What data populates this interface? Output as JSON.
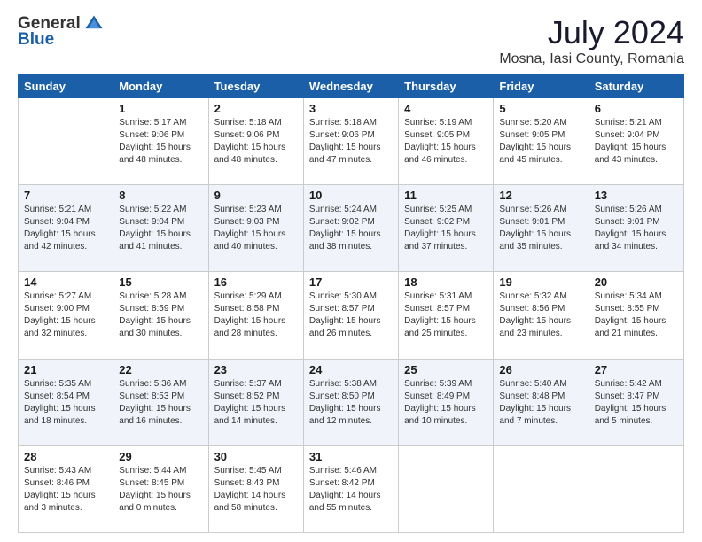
{
  "header": {
    "logo": {
      "general": "General",
      "blue": "Blue"
    },
    "title": "July 2024",
    "subtitle": "Mosna, Iasi County, Romania"
  },
  "days_of_week": [
    "Sunday",
    "Monday",
    "Tuesday",
    "Wednesday",
    "Thursday",
    "Friday",
    "Saturday"
  ],
  "weeks": [
    [
      {
        "day": "",
        "info": ""
      },
      {
        "day": "1",
        "info": "Sunrise: 5:17 AM\nSunset: 9:06 PM\nDaylight: 15 hours\nand 48 minutes."
      },
      {
        "day": "2",
        "info": "Sunrise: 5:18 AM\nSunset: 9:06 PM\nDaylight: 15 hours\nand 48 minutes."
      },
      {
        "day": "3",
        "info": "Sunrise: 5:18 AM\nSunset: 9:06 PM\nDaylight: 15 hours\nand 47 minutes."
      },
      {
        "day": "4",
        "info": "Sunrise: 5:19 AM\nSunset: 9:05 PM\nDaylight: 15 hours\nand 46 minutes."
      },
      {
        "day": "5",
        "info": "Sunrise: 5:20 AM\nSunset: 9:05 PM\nDaylight: 15 hours\nand 45 minutes."
      },
      {
        "day": "6",
        "info": "Sunrise: 5:21 AM\nSunset: 9:04 PM\nDaylight: 15 hours\nand 43 minutes."
      }
    ],
    [
      {
        "day": "7",
        "info": "Sunrise: 5:21 AM\nSunset: 9:04 PM\nDaylight: 15 hours\nand 42 minutes."
      },
      {
        "day": "8",
        "info": "Sunrise: 5:22 AM\nSunset: 9:04 PM\nDaylight: 15 hours\nand 41 minutes."
      },
      {
        "day": "9",
        "info": "Sunrise: 5:23 AM\nSunset: 9:03 PM\nDaylight: 15 hours\nand 40 minutes."
      },
      {
        "day": "10",
        "info": "Sunrise: 5:24 AM\nSunset: 9:02 PM\nDaylight: 15 hours\nand 38 minutes."
      },
      {
        "day": "11",
        "info": "Sunrise: 5:25 AM\nSunset: 9:02 PM\nDaylight: 15 hours\nand 37 minutes."
      },
      {
        "day": "12",
        "info": "Sunrise: 5:26 AM\nSunset: 9:01 PM\nDaylight: 15 hours\nand 35 minutes."
      },
      {
        "day": "13",
        "info": "Sunrise: 5:26 AM\nSunset: 9:01 PM\nDaylight: 15 hours\nand 34 minutes."
      }
    ],
    [
      {
        "day": "14",
        "info": "Sunrise: 5:27 AM\nSunset: 9:00 PM\nDaylight: 15 hours\nand 32 minutes."
      },
      {
        "day": "15",
        "info": "Sunrise: 5:28 AM\nSunset: 8:59 PM\nDaylight: 15 hours\nand 30 minutes."
      },
      {
        "day": "16",
        "info": "Sunrise: 5:29 AM\nSunset: 8:58 PM\nDaylight: 15 hours\nand 28 minutes."
      },
      {
        "day": "17",
        "info": "Sunrise: 5:30 AM\nSunset: 8:57 PM\nDaylight: 15 hours\nand 26 minutes."
      },
      {
        "day": "18",
        "info": "Sunrise: 5:31 AM\nSunset: 8:57 PM\nDaylight: 15 hours\nand 25 minutes."
      },
      {
        "day": "19",
        "info": "Sunrise: 5:32 AM\nSunset: 8:56 PM\nDaylight: 15 hours\nand 23 minutes."
      },
      {
        "day": "20",
        "info": "Sunrise: 5:34 AM\nSunset: 8:55 PM\nDaylight: 15 hours\nand 21 minutes."
      }
    ],
    [
      {
        "day": "21",
        "info": "Sunrise: 5:35 AM\nSunset: 8:54 PM\nDaylight: 15 hours\nand 18 minutes."
      },
      {
        "day": "22",
        "info": "Sunrise: 5:36 AM\nSunset: 8:53 PM\nDaylight: 15 hours\nand 16 minutes."
      },
      {
        "day": "23",
        "info": "Sunrise: 5:37 AM\nSunset: 8:52 PM\nDaylight: 15 hours\nand 14 minutes."
      },
      {
        "day": "24",
        "info": "Sunrise: 5:38 AM\nSunset: 8:50 PM\nDaylight: 15 hours\nand 12 minutes."
      },
      {
        "day": "25",
        "info": "Sunrise: 5:39 AM\nSunset: 8:49 PM\nDaylight: 15 hours\nand 10 minutes."
      },
      {
        "day": "26",
        "info": "Sunrise: 5:40 AM\nSunset: 8:48 PM\nDaylight: 15 hours\nand 7 minutes."
      },
      {
        "day": "27",
        "info": "Sunrise: 5:42 AM\nSunset: 8:47 PM\nDaylight: 15 hours\nand 5 minutes."
      }
    ],
    [
      {
        "day": "28",
        "info": "Sunrise: 5:43 AM\nSunset: 8:46 PM\nDaylight: 15 hours\nand 3 minutes."
      },
      {
        "day": "29",
        "info": "Sunrise: 5:44 AM\nSunset: 8:45 PM\nDaylight: 15 hours\nand 0 minutes."
      },
      {
        "day": "30",
        "info": "Sunrise: 5:45 AM\nSunset: 8:43 PM\nDaylight: 14 hours\nand 58 minutes."
      },
      {
        "day": "31",
        "info": "Sunrise: 5:46 AM\nSunset: 8:42 PM\nDaylight: 14 hours\nand 55 minutes."
      },
      {
        "day": "",
        "info": ""
      },
      {
        "day": "",
        "info": ""
      },
      {
        "day": "",
        "info": ""
      }
    ]
  ]
}
